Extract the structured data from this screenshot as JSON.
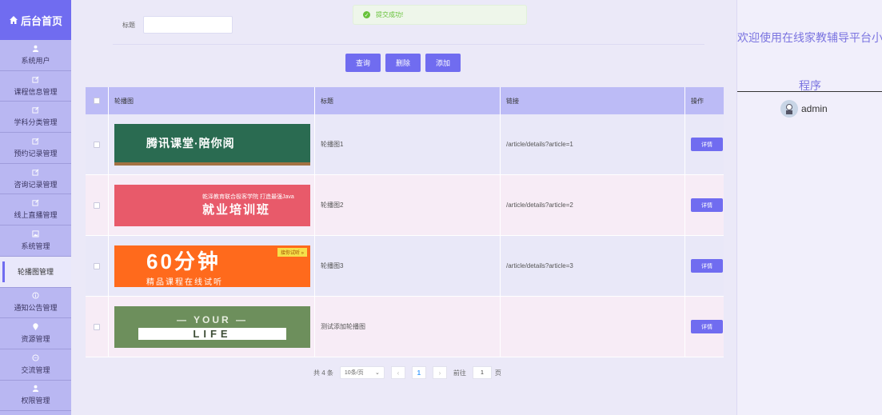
{
  "sidebar": {
    "brand": "后台首页",
    "items": [
      {
        "label": "系统用户",
        "icon": "user-icon"
      },
      {
        "label": "课程信息管理",
        "icon": "edit-icon"
      },
      {
        "label": "学科分类管理",
        "icon": "edit-icon"
      },
      {
        "label": "预约记录管理",
        "icon": "edit-icon"
      },
      {
        "label": "咨询记录管理",
        "icon": "edit-icon"
      },
      {
        "label": "线上直播管理",
        "icon": "edit-icon"
      },
      {
        "label": "系统管理",
        "icon": "image-icon"
      },
      {
        "label": "轮播图管理",
        "icon": "",
        "active": true
      },
      {
        "label": "通知公告管理",
        "icon": "info-icon"
      },
      {
        "label": "资源管理",
        "icon": "location-icon"
      },
      {
        "label": "交流管理",
        "icon": "chat-icon"
      },
      {
        "label": "权限管理",
        "icon": "user-icon"
      }
    ]
  },
  "toast": {
    "message": "提交成功!",
    "icon": "check-circle-icon",
    "color": "#67c23a"
  },
  "search": {
    "label": "标题",
    "value": ""
  },
  "toolbar": {
    "query": "查询",
    "delete": "删除",
    "add": "添加"
  },
  "table": {
    "headers": [
      "轮播图",
      "标题",
      "链接",
      "操作"
    ],
    "rows": [
      {
        "banner_text": "腾讯课堂·陪你阅",
        "banner_sub": "",
        "title": "轮播图1",
        "link": "/article/details?article=1",
        "action": "详情"
      },
      {
        "banner_text": "就业培训班",
        "banner_sub": "乾泽教育联合极客学院 打造最强Java",
        "title": "轮播图2",
        "link": "/article/details?article=2",
        "action": "详情"
      },
      {
        "banner_text": "60分钟",
        "banner_sub": "精品课程在线试听",
        "banner_tag": "接你试听 »",
        "title": "轮播图3",
        "link": "/article/details?article=3",
        "action": "详情"
      },
      {
        "banner_text": "— YOUR —",
        "banner_sub": "LIFE",
        "title": "测试添加轮播图",
        "link": "",
        "action": "详情"
      }
    ]
  },
  "pagination": {
    "total": "共 4 条",
    "page_size": "10条/页",
    "current": "1",
    "goto_prefix": "前往",
    "goto_value": "1",
    "goto_suffix": "页"
  },
  "right_panel": {
    "welcome": "欢迎使用在线家教辅导平台小程序",
    "username": "admin"
  },
  "colors": {
    "accent": "#706cf0",
    "sidebar": "#b9b7f2",
    "header": "#bcbbf6"
  }
}
